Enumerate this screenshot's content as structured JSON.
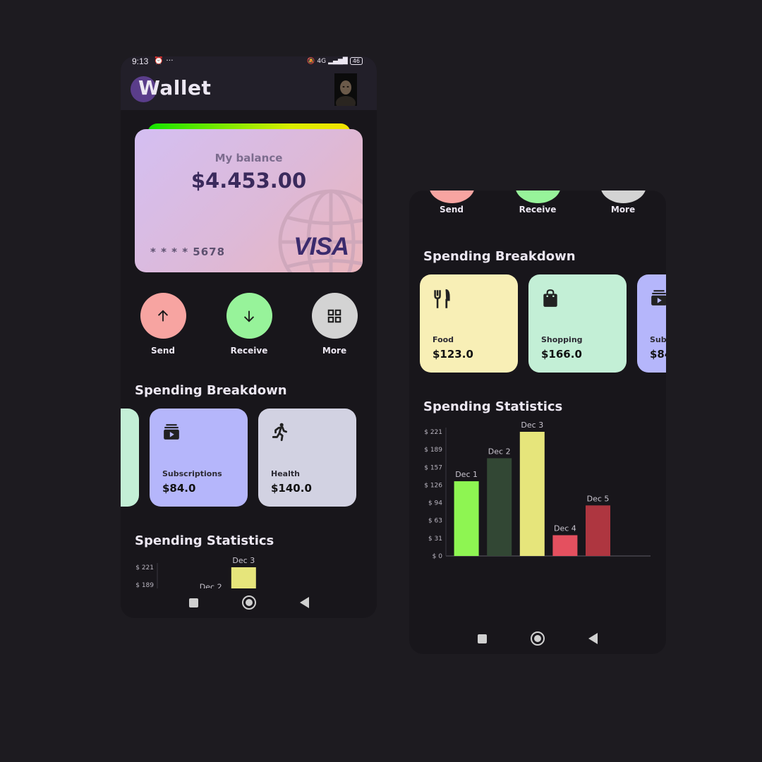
{
  "status_bar": {
    "time": "9:13",
    "extras": "⏰ ···",
    "network": "4G",
    "battery": "46"
  },
  "app": {
    "title": "Wallet"
  },
  "card": {
    "balance_label": "My balance",
    "balance": "$4.453.00",
    "number": "* * * * 5678",
    "brand": "VISA"
  },
  "actions": [
    {
      "label": "Send",
      "icon": "arrow-up-icon",
      "color": "#f7a4a1"
    },
    {
      "label": "Receive",
      "icon": "arrow-down-icon",
      "color": "#97f39a"
    },
    {
      "label": "More",
      "icon": "grid-icon",
      "color": "#d3d3d3"
    }
  ],
  "spending_breakdown": {
    "title": "Spending Breakdown",
    "categories": [
      {
        "name": "Food",
        "amount": "$123.0",
        "icon": "restaurant-icon",
        "color": "#f8efb6"
      },
      {
        "name": "Shopping",
        "amount": "$166.0",
        "icon": "shopping-bag-icon",
        "color": "#c3efd6"
      },
      {
        "name": "Subscriptions",
        "amount": "$84.0",
        "icon": "subscriptions-icon",
        "color": "#b5b6fb"
      },
      {
        "name": "Health",
        "amount": "$140.0",
        "icon": "running-icon",
        "color": "#d2d2e2"
      }
    ]
  },
  "spending_statistics": {
    "title": "Spending Statistics"
  },
  "chart_data": {
    "type": "bar",
    "categories": [
      "Dec 1",
      "Dec 2",
      "Dec 3",
      "Dec 4",
      "Dec 5"
    ],
    "values": [
      133,
      174,
      221,
      37,
      90
    ],
    "colors": [
      "#8ef552",
      "#324734",
      "#e6e57b",
      "#e4505f",
      "#ae3640"
    ],
    "yticks": [
      "$ 0",
      "$ 31",
      "$ 63",
      "$ 94",
      "$ 126",
      "$ 157",
      "$ 189",
      "$ 221"
    ],
    "ylim": [
      0,
      221
    ],
    "title": "",
    "xlabel": "",
    "ylabel": "",
    "grid": false
  },
  "second_screen": {
    "action_labels": [
      "Send",
      "Receive",
      "More"
    ]
  }
}
